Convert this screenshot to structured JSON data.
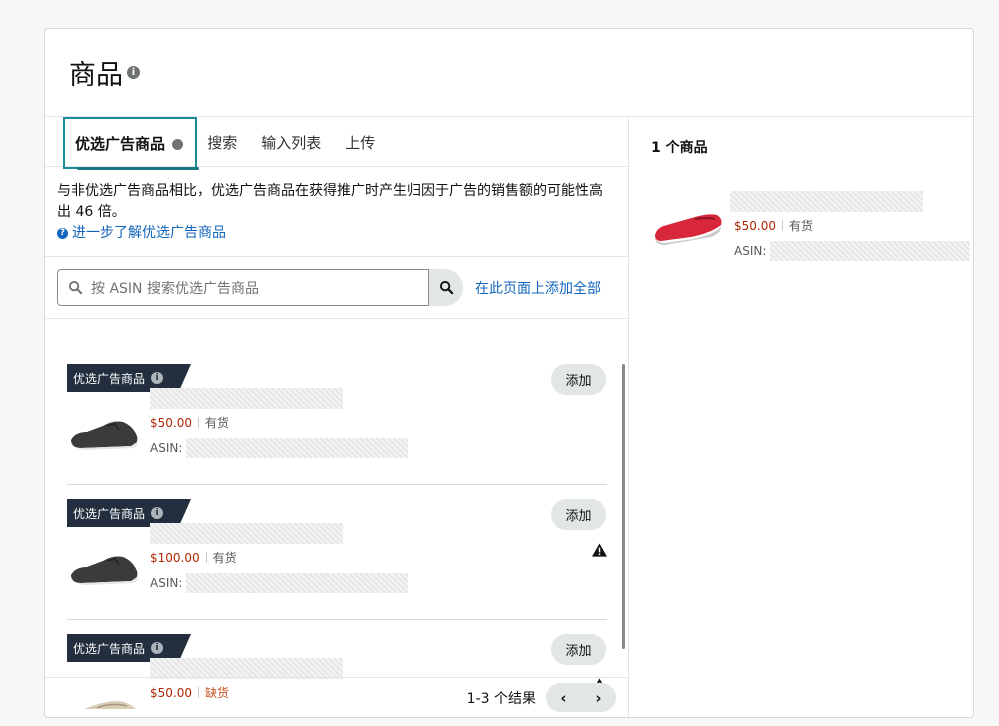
{
  "header": {
    "title": "商品",
    "info_icon": "i"
  },
  "tabs": [
    {
      "label": "优选广告商品",
      "active": true
    },
    {
      "label": "搜索"
    },
    {
      "label": "输入列表"
    },
    {
      "label": "上传"
    }
  ],
  "description": {
    "text": "与非优选广告商品相比，优选广告商品在获得推广时产生归因于广告的销售额的可能性高出 46 倍。",
    "link": "进一步了解优选广告商品"
  },
  "search": {
    "placeholder": "按 ASIN 搜索优选广告商品",
    "add_all": "在此页面上添加全部"
  },
  "items": [
    {
      "badge": "优选广告商品",
      "add": "添加",
      "price": "$50.00",
      "stock": "有货",
      "asin_label": "ASIN:",
      "warning": false
    },
    {
      "badge": "优选广告商品",
      "add": "添加",
      "price": "$100.00",
      "stock": "有货",
      "asin_label": "ASIN:",
      "warning": true
    },
    {
      "badge": "优选广告商品",
      "add": "添加",
      "price": "$50.00",
      "stock": "缺货",
      "asin_label": "ASIN:",
      "warning": true
    }
  ],
  "pager": {
    "results": "1-3 个结果",
    "prev": "‹",
    "next": "›"
  },
  "selected": {
    "title": "1 个商品",
    "item": {
      "price": "$50.00",
      "stock": "有货",
      "asin_label": "ASIN:"
    }
  },
  "colors": {
    "price": "#b12704",
    "link": "#1166bb",
    "badge_bg": "#232f3e",
    "tab_focus": "#1a8c99"
  }
}
